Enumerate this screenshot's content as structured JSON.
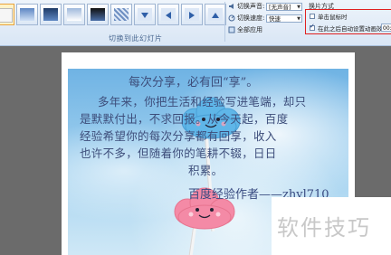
{
  "ribbon": {
    "group_label": "切换到此幻灯片",
    "transition_thumbs": [
      "none",
      "fade",
      "fade-black",
      "cut",
      "cut-black",
      "dissolve",
      "push-down",
      "push-left",
      "push-right",
      "push-up"
    ],
    "sound": {
      "label": "切换声音:",
      "value": "[无声音]"
    },
    "speed": {
      "label": "切换速度:",
      "value": "快速"
    },
    "apply_all_label": "全部应用",
    "advance": {
      "title": "换片方式",
      "on_click_label": "单击鼠标时",
      "on_click_checked": false,
      "auto_label": "在此之后自动设置动画效果:",
      "auto_checked": true,
      "time_value": "00:"
    }
  },
  "slide": {
    "title": "每次分享，必有回“享”。",
    "body_lines": [
      "多年来，你把生活和经验写进笔端，却只",
      "是默默付出，不求回报。从今天起，百度",
      "经验希望你的每次分享都有回享，收入",
      "也许不多，但随着你的笔耕不辍，日日",
      "积累。"
    ],
    "author": "百度经验作者——zhyl710"
  },
  "watermark": {
    "text": "软件技巧"
  },
  "colors": {
    "highlight": "#e02020",
    "ribbon_bg": "#dfe9f6",
    "slide_text": "#3d4d7a"
  }
}
